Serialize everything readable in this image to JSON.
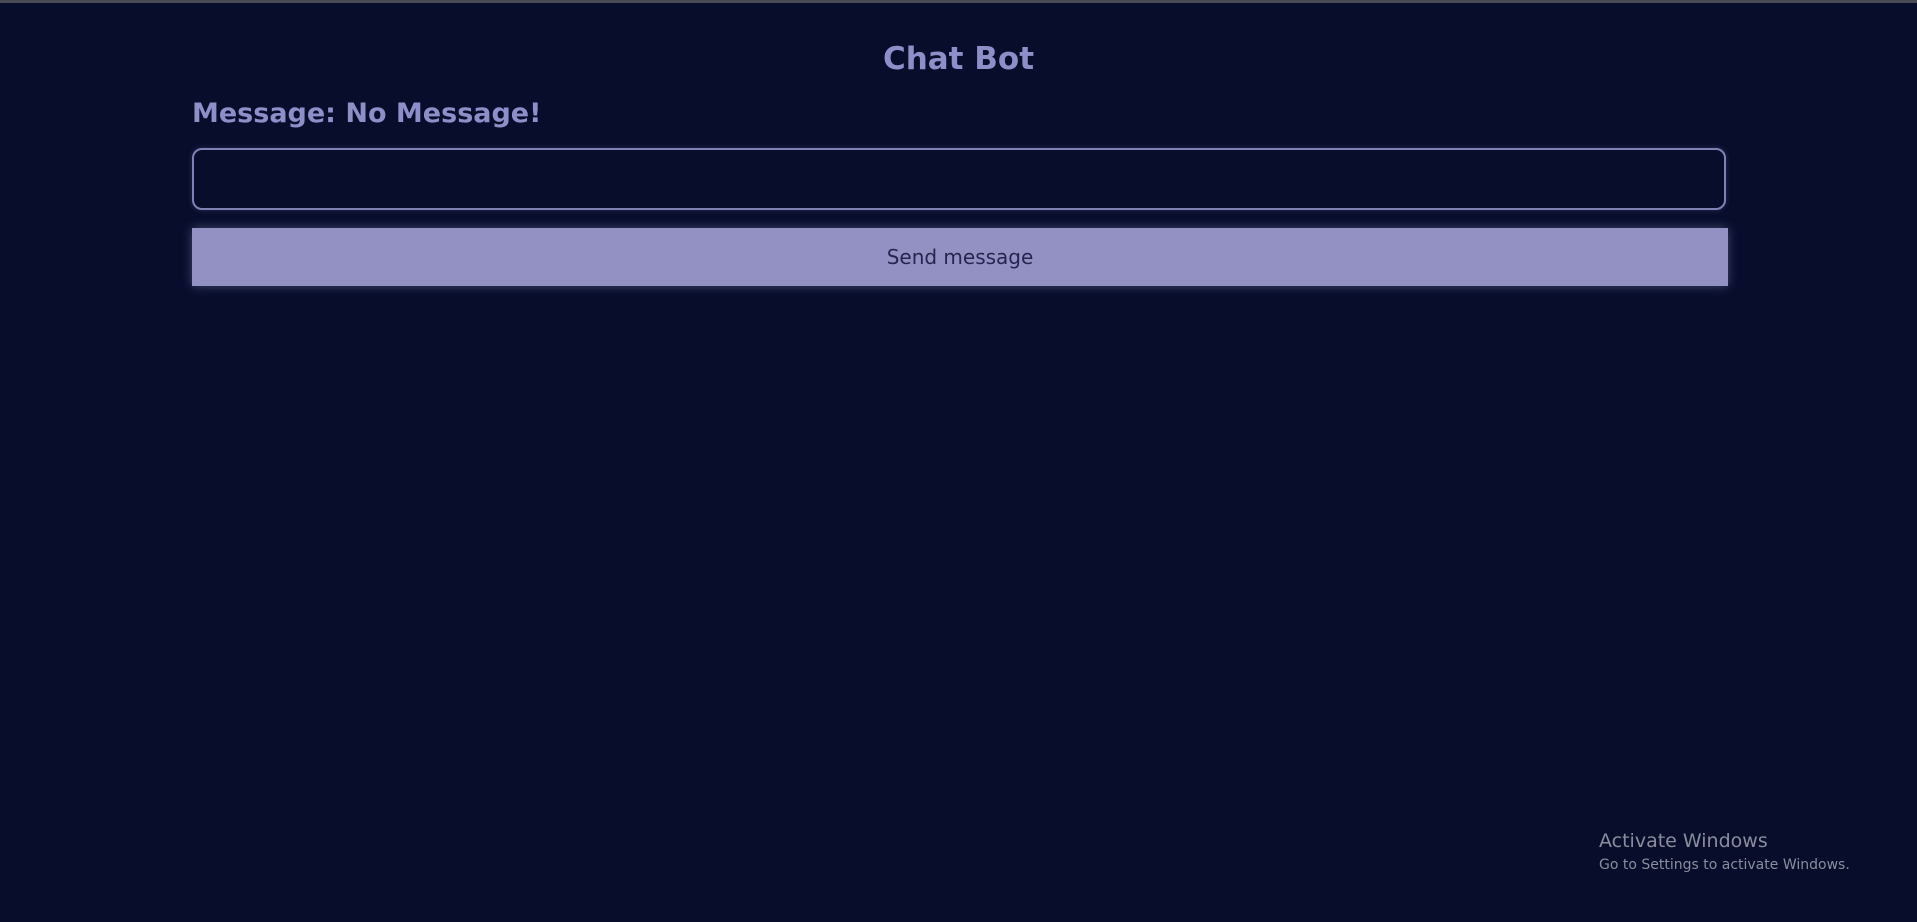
{
  "app": {
    "title": "Chat Bot"
  },
  "message": {
    "label": "Message:",
    "value": "No Message!"
  },
  "input": {
    "value": "",
    "placeholder": ""
  },
  "send_button": {
    "label": "Send message"
  },
  "watermark": {
    "title": "Activate Windows",
    "subtitle": "Go to Settings to activate Windows."
  },
  "colors": {
    "background": "#070d2b",
    "accent": "#8e8fc9",
    "button": "#9391c4"
  }
}
